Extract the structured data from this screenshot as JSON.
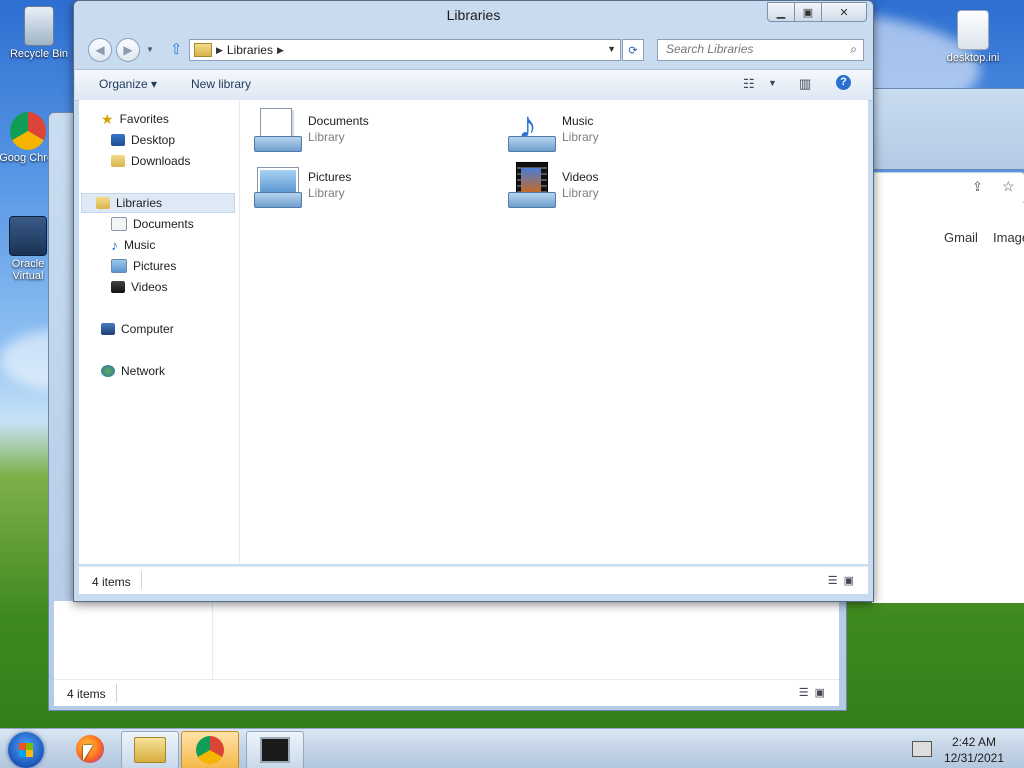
{
  "desktop": {
    "icons": [
      {
        "label": "Recycle Bin"
      },
      {
        "label": "Goog Chror"
      },
      {
        "label": "Oracle Virtual"
      },
      {
        "label": "desktop.ini"
      }
    ]
  },
  "back_window": {
    "status_count": "4 items"
  },
  "back_browser": {
    "links": [
      "Gmail",
      "Image"
    ]
  },
  "explorer": {
    "title": "Libraries",
    "address": {
      "crumb": "Libraries"
    },
    "search": {
      "placeholder": "Search Libraries"
    },
    "toolbar": {
      "organize": "Organize ▾",
      "new_library": "New library"
    },
    "nav": {
      "favorites": "Favorites",
      "desktop": "Desktop",
      "downloads": "Downloads",
      "libraries": "Libraries",
      "documents": "Documents",
      "music": "Music",
      "pictures": "Pictures",
      "videos": "Videos",
      "computer": "Computer",
      "network": "Network"
    },
    "items": [
      {
        "name": "Documents",
        "type": "Library",
        "icon": "documents-library-icon"
      },
      {
        "name": "Music",
        "type": "Library",
        "icon": "music-library-icon"
      },
      {
        "name": "Pictures",
        "type": "Library",
        "icon": "pictures-library-icon"
      },
      {
        "name": "Videos",
        "type": "Library",
        "icon": "videos-library-icon"
      }
    ],
    "status": {
      "count": "4 items"
    }
  },
  "taskbar": {
    "time": "2:42 AM",
    "date": "12/31/2021"
  }
}
